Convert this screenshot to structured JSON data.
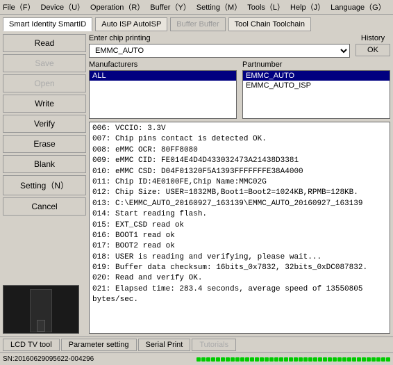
{
  "menubar": {
    "items": [
      {
        "label": "File（F）"
      },
      {
        "label": "Device（U）"
      },
      {
        "label": "Operation（R）"
      },
      {
        "label": "Buffer（Y）"
      },
      {
        "label": "Setting（M）"
      },
      {
        "label": "Tools（L）"
      },
      {
        "label": "Help（J）"
      },
      {
        "label": "Language（G）"
      }
    ]
  },
  "toolbar": {
    "tabs": [
      {
        "label": "Smart Identity SmartID",
        "active": true
      },
      {
        "label": "Auto ISP AutoISP",
        "active": false
      },
      {
        "label": "Buffer Buffer",
        "disabled": true
      },
      {
        "label": "Tool Chain Toolchain",
        "active": false
      }
    ]
  },
  "sidebar": {
    "buttons": [
      {
        "label": "Read",
        "disabled": false
      },
      {
        "label": "Save",
        "disabled": true
      },
      {
        "label": "Open",
        "disabled": true
      },
      {
        "label": "Write",
        "disabled": false
      },
      {
        "label": "Verify",
        "disabled": false
      },
      {
        "label": "Erase",
        "disabled": false
      },
      {
        "label": "Blank",
        "disabled": false
      },
      {
        "label": "Setting（N）",
        "disabled": false
      },
      {
        "label": "Cancel",
        "disabled": false
      }
    ]
  },
  "chip_section": {
    "enter_label": "Enter chip printing",
    "history_label": "History",
    "history_btn": "OK",
    "selected_chip": "EMMC_AUTO",
    "manufacturers_label": "Manufacturers",
    "manufacturers": [
      {
        "label": "ALL",
        "selected": true
      }
    ],
    "partnumber_label": "Partnumber",
    "partnumbers": [
      {
        "label": "EMMC_AUTO",
        "selected": true
      },
      {
        "label": "EMMC_AUTO_ISP",
        "selected": false
      }
    ]
  },
  "log": {
    "lines": [
      "006: VCCIO: 3.3V",
      "007: Chip pins contact is detected OK.",
      "008: eMMC OCR: 80FF8080",
      "009: eMMC CID: FE014E4D4D433032473A21438D3381",
      "010: eMMC CSD: D04F01320F5A1393FFFFFFFE38A4000",
      "011: Chip ID:4E0100FE,Chip Name:MMC02G",
      "012: Chip Size: USER=1832MB,Boot1=Boot2=1024KB,RPMB=128KB.",
      "013: C:\\EMMC_AUTO_20160927_163139\\EMMC_AUTO_20160927_163139",
      "014: Start reading flash.",
      "015: EXT_CSD read ok",
      "016: BOOT1 read ok",
      "017: BOOT2 read ok",
      "018: USER is reading and verifying, please wait...",
      "019: Buffer data checksum: 16bits_0x7832, 32bits_0xDC087832.",
      "020: Read and verify OK.",
      "021: Elapsed time: 283.4 seconds, average speed of 13550805 bytes/sec."
    ]
  },
  "bottom_tabs": [
    {
      "label": "LCD TV tool"
    },
    {
      "label": "Parameter setting"
    },
    {
      "label": "Serial Print"
    },
    {
      "label": "Tutorials",
      "disabled": true
    }
  ],
  "statusbar": {
    "text": "SN:20160629095622-004296"
  }
}
